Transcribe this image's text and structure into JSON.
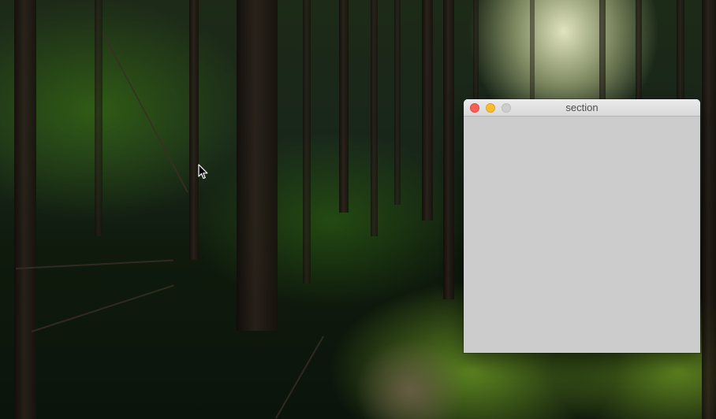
{
  "desktop": {
    "wallpaper": "forest-wallpaper"
  },
  "window": {
    "title": "section",
    "controls": {
      "close_color": "#fc5f57",
      "minimize_color": "#fdbc2e",
      "zoom_color": "#cdcdcd"
    },
    "content_color": "#cccccc"
  },
  "cursor": {
    "icon": "arrow-cursor-icon"
  }
}
